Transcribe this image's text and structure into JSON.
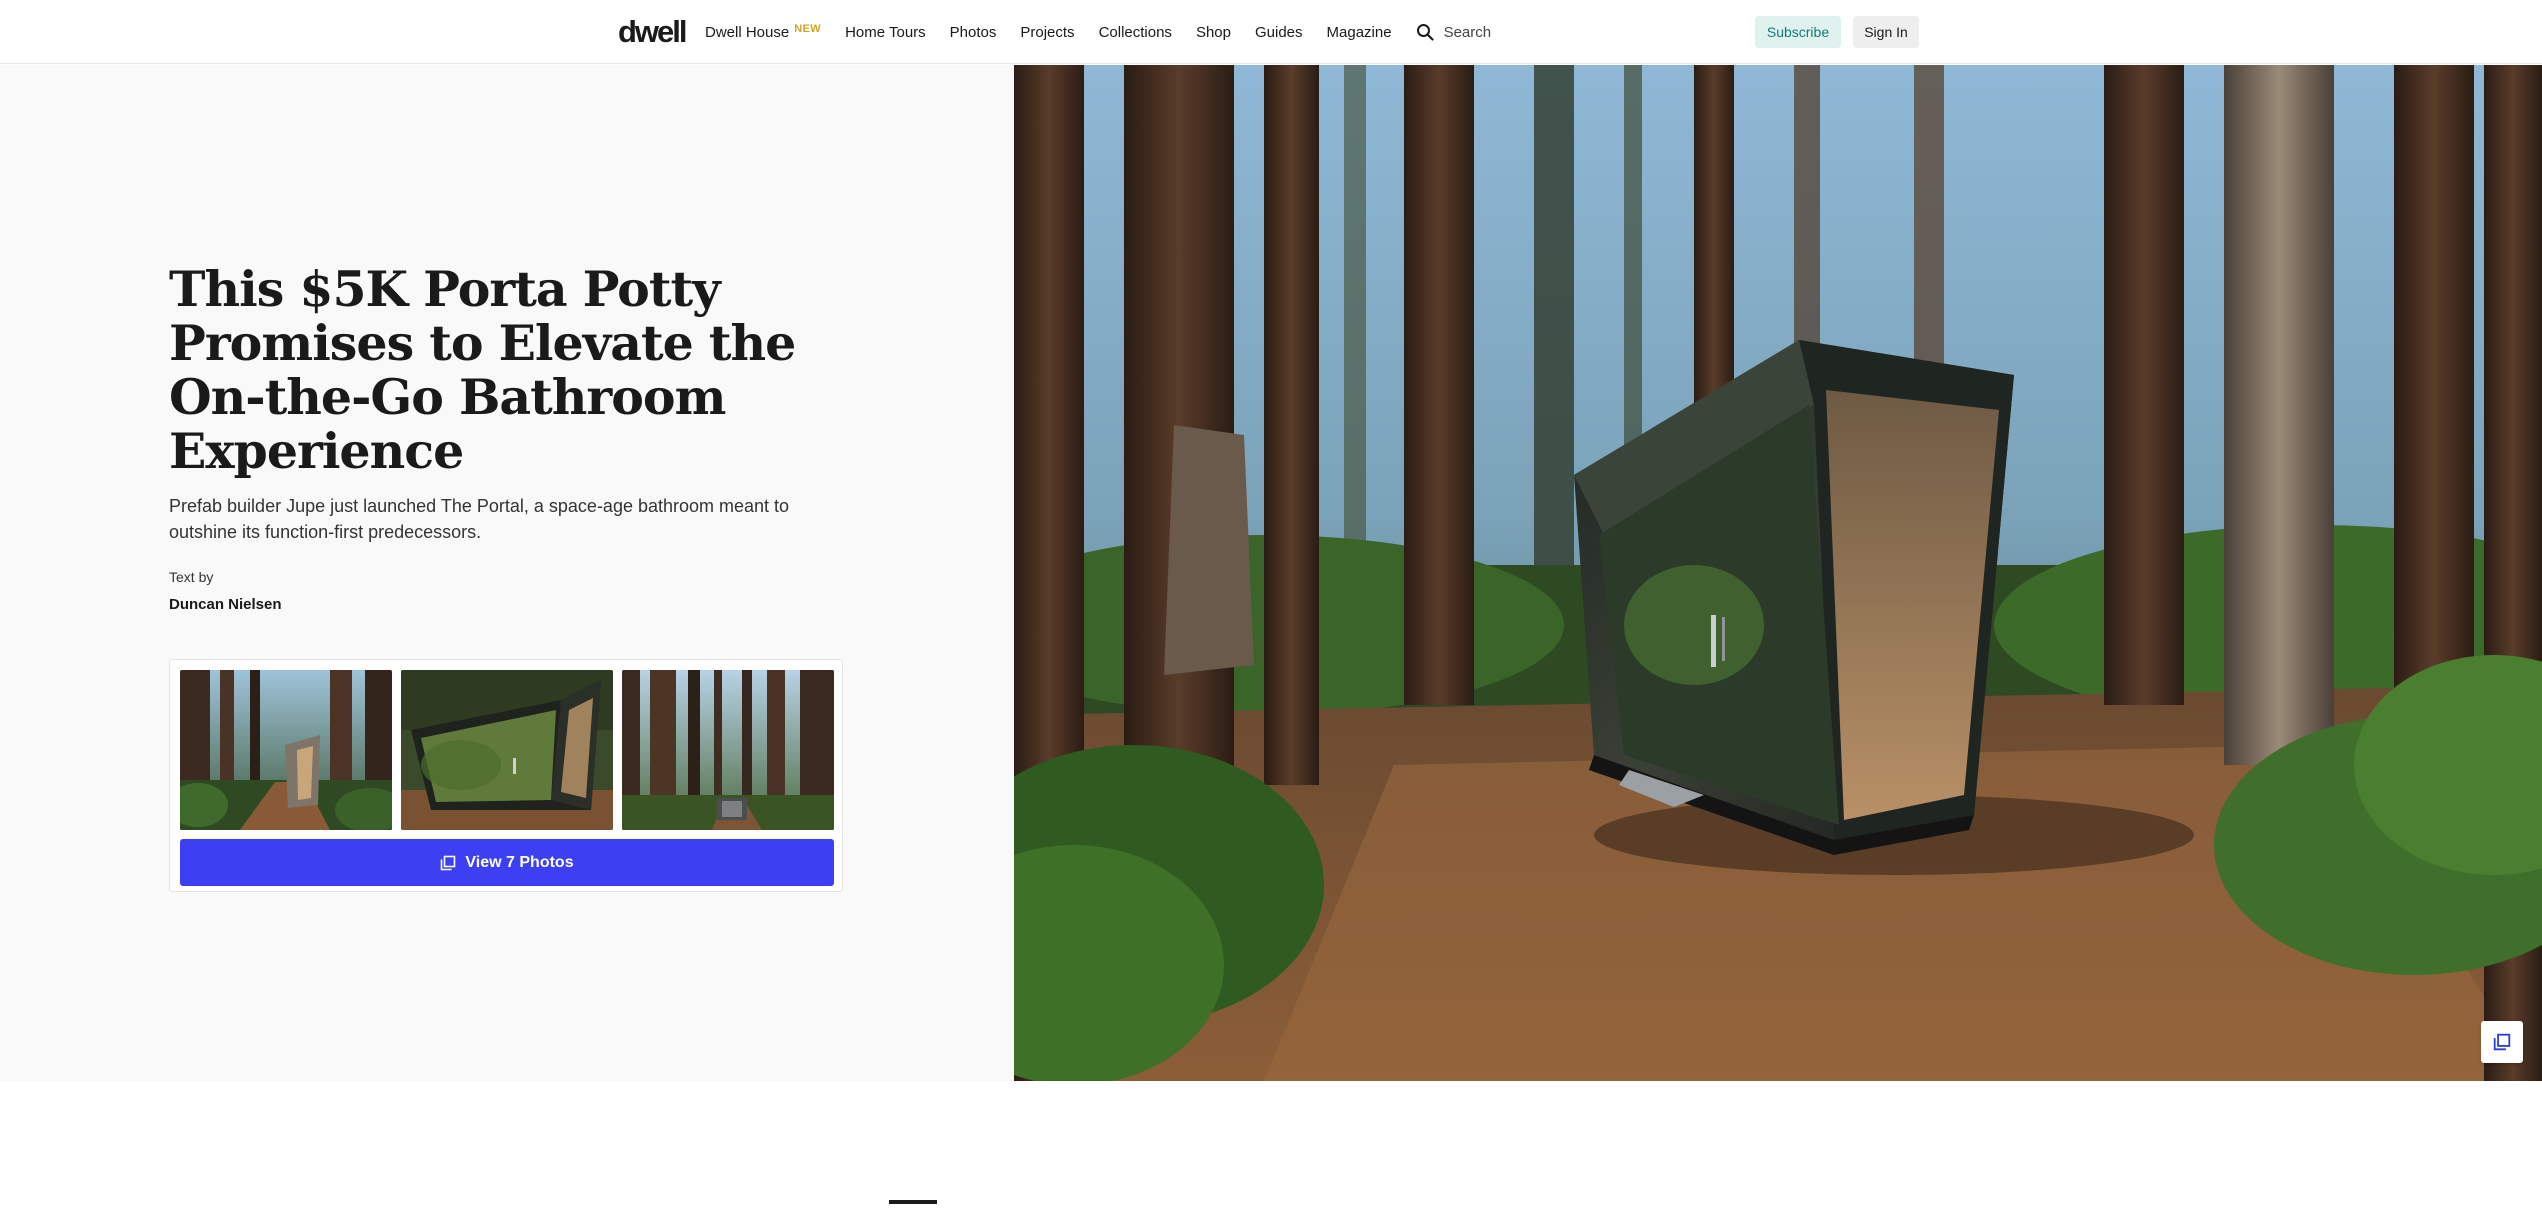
{
  "header": {
    "logo": "dwell",
    "nav": [
      {
        "label": "Dwell House",
        "badge": "NEW"
      },
      {
        "label": "Home Tours"
      },
      {
        "label": "Photos"
      },
      {
        "label": "Projects"
      },
      {
        "label": "Collections"
      },
      {
        "label": "Shop"
      },
      {
        "label": "Guides"
      },
      {
        "label": "Magazine"
      }
    ],
    "search_label": "Search",
    "search_icon": "search-icon",
    "subscribe_label": "Subscribe",
    "signin_label": "Sign In"
  },
  "article": {
    "title": "This $5K Porta Potty Promises to Elevate the On-the-Go Bathroom Experience",
    "subtitle": "Prefab builder Jupe just launched The Portal, a space-age bathroom meant to outshine its function-first predecessors.",
    "byline_label": "Text by",
    "author": "Duncan Nielsen"
  },
  "gallery": {
    "button_label": "View 7 Photos",
    "button_icon": "gallery-icon",
    "thumbnails": [
      "forest-portal-front",
      "portal-closeup",
      "forest-portal-distant"
    ]
  },
  "hero_image": {
    "subject": "mirrored portal bathroom in redwood forest",
    "corner_icon": "gallery-icon"
  },
  "colors": {
    "accent_blue": "#3d3ff2",
    "subscribe_bg": "#dff2f0",
    "subscribe_text": "#167a72",
    "new_badge": "#d1a52b"
  }
}
